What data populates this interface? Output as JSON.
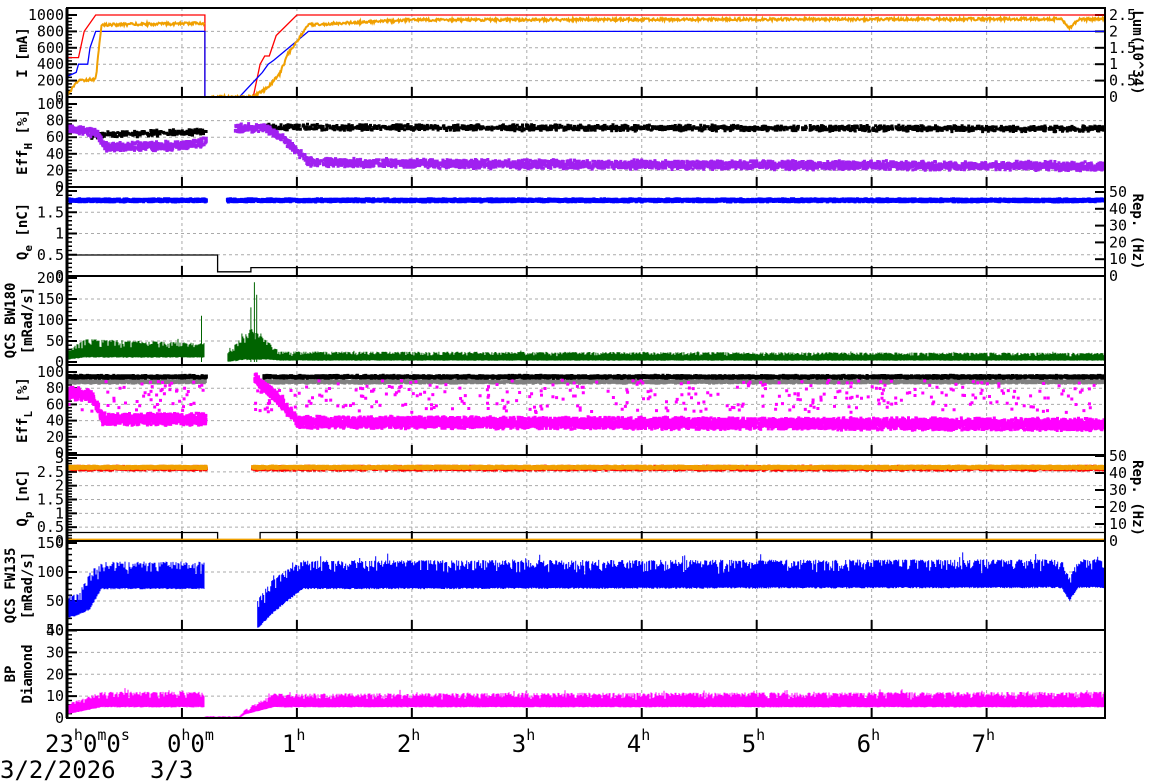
{
  "chart_data": {
    "type": "line",
    "title": "",
    "x_axis": {
      "unit": "hours since 23h0m0s",
      "range": [
        0,
        9.03
      ],
      "tick_labels": [
        {
          "t": 0,
          "text": "23h0m0s"
        },
        {
          "t": 1,
          "text": "0h0m"
        },
        {
          "t": 2,
          "text": "1h"
        },
        {
          "t": 3,
          "text": "2h"
        },
        {
          "t": 4,
          "text": "3h"
        },
        {
          "t": 5,
          "text": "4h"
        },
        {
          "t": 6,
          "text": "5h"
        },
        {
          "t": 7,
          "text": "6h"
        },
        {
          "t": 8,
          "text": "7h"
        }
      ],
      "date_labels": [
        {
          "t": 0,
          "text": "3/2/2026"
        },
        {
          "t": 0.85,
          "text": "3/3"
        }
      ]
    },
    "panels": [
      {
        "id": "current",
        "ylabel": "I [mA]",
        "ylim": [
          0,
          1000
        ],
        "yticks": [
          0,
          200,
          400,
          600,
          800,
          1000
        ],
        "right": {
          "label": "Lum(10^34)",
          "ylim": [
            0,
            2.5
          ],
          "yticks": [
            "0",
            "0.5",
            "1",
            "1.5",
            "2",
            "2.5"
          ]
        },
        "series": [
          {
            "name": "ler-current",
            "color": "#ff0000",
            "kind": "line",
            "segments": [
              [
                [
                  0,
                  480
                ],
                [
                  0.1,
                  480
                ],
                [
                  0.15,
                  800
                ],
                [
                  0.25,
                  1000
                ],
                [
                  1.2,
                  1000
                ],
                [
                  1.2,
                  0
                ],
                [
                  1.62,
                  0
                ],
                [
                  1.68,
                  400
                ],
                [
                  1.72,
                  500
                ],
                [
                  1.76,
                  500
                ],
                [
                  1.82,
                  750
                ],
                [
                  2.0,
                  1000
                ],
                [
                  9.03,
                  1000
                ]
              ]
            ]
          },
          {
            "name": "her-current",
            "color": "#0000ff",
            "kind": "line",
            "segments": [
              [
                [
                  0,
                  250
                ],
                [
                  0.08,
                  300
                ],
                [
                  0.1,
                  400
                ],
                [
                  0.18,
                  400
                ],
                [
                  0.2,
                  600
                ],
                [
                  0.25,
                  800
                ],
                [
                  1.2,
                  800
                ],
                [
                  1.2,
                  0
                ],
                [
                  1.5,
                  0
                ],
                [
                  1.7,
                  300
                ],
                [
                  1.75,
                  400
                ],
                [
                  1.8,
                  450
                ],
                [
                  2.1,
                  800
                ],
                [
                  9.03,
                  800
                ]
              ]
            ]
          },
          {
            "name": "luminosity",
            "color": "#f0a000",
            "kind": "noisyline",
            "axis": "right",
            "noise": 0.04,
            "segments": [
              [
                [
                  0,
                  0.05
                ],
                [
                  0.1,
                  0.5
                ],
                [
                  0.25,
                  0.55
                ],
                [
                  0.3,
                  2.2
                ],
                [
                  1.2,
                  2.25
                ]
              ],
              [
                [
                  1.25,
                  0
                ],
                [
                  1.62,
                  0
                ],
                [
                  1.75,
                  0.3
                ],
                [
                  1.85,
                  0.7
                ],
                [
                  1.92,
                  1.3
                ],
                [
                  2.1,
                  2.2
                ],
                [
                  3,
                  2.35
                ],
                [
                  8.65,
                  2.38
                ],
                [
                  8.72,
                  2.1
                ],
                [
                  8.8,
                  2.36
                ],
                [
                  9.03,
                  2.38
                ]
              ]
            ]
          }
        ]
      },
      {
        "id": "eff-her",
        "ylabel": "Eff",
        "ysub": "H",
        "yunit": "[%]",
        "ylim": [
          0,
          100
        ],
        "yticks": [
          0,
          20,
          40,
          60,
          80,
          100
        ],
        "series": [
          {
            "name": "eff-h-black",
            "color": "#000000",
            "kind": "scatter",
            "noise": 4,
            "density": 700,
            "segments": [
              [
                [
                  0.2,
                  62
                ],
                [
                  1.2,
                  67
                ]
              ],
              [
                [
                  1.7,
                  72
                ],
                [
                  9.03,
                  70
                ]
              ]
            ]
          },
          {
            "name": "eff-h-purple",
            "color": "#a020f0",
            "kind": "scatter",
            "noise": 6,
            "density": 1400,
            "segments": [
              [
                [
                  0,
                  70
                ],
                [
                  0.25,
                  65
                ],
                [
                  0.32,
                  48
                ],
                [
                  1.0,
                  50
                ],
                [
                  1.2,
                  55
                ]
              ],
              [
                [
                  1.45,
                  70
                ],
                [
                  1.7,
                  72
                ],
                [
                  1.9,
                  55
                ],
                [
                  2.1,
                  30
                ],
                [
                  3,
                  28
                ],
                [
                  9.03,
                  25
                ]
              ]
            ]
          }
        ]
      },
      {
        "id": "charge-e",
        "ylabel": "Q",
        "ysub": "e",
        "yunit": "[nC]",
        "ylim": [
          0,
          2
        ],
        "yticks": [
          "0",
          "0.5",
          "1",
          "1.5",
          "2"
        ],
        "right": {
          "label": "Rep. (Hz)",
          "ylim": [
            0,
            50
          ],
          "yticks": [
            "0",
            "10",
            "20",
            "30",
            "40",
            "50"
          ]
        },
        "series": [
          {
            "name": "qe-blue",
            "color": "#0000ff",
            "kind": "scatter",
            "noise": 0.04,
            "density": 2500,
            "segments": [
              [
                [
                  0,
                  1.78
                ],
                [
                  1.2,
                  1.78
                ]
              ],
              [
                [
                  1.38,
                  1.78
                ],
                [
                  9.03,
                  1.78
                ]
              ]
            ]
          },
          {
            "name": "rep-e",
            "color": "#000000",
            "kind": "line",
            "axis": "right",
            "segments": [
              [
                [
                  0,
                  12.5
                ],
                [
                  1.31,
                  12.5
                ],
                [
                  1.31,
                  2.5
                ],
                [
                  1.6,
                  2.5
                ],
                [
                  1.6,
                  5
                ],
                [
                  9.03,
                  5
                ]
              ]
            ]
          }
        ]
      },
      {
        "id": "bw180",
        "ylabel": "QCS BW180",
        "yunit": "[mRad/s]",
        "ylim": [
          0,
          200
        ],
        "yticks": [
          0,
          50,
          100,
          150,
          200
        ],
        "series": [
          {
            "name": "bw180-dose",
            "color": "#006400",
            "kind": "band",
            "segments": [
              [
                [
                  0,
                  5,
                  25
                ],
                [
                  0.15,
                  10,
                  55
                ],
                [
                  1.2,
                  10,
                  45
                ]
              ],
              [
                [
                  1.4,
                  0,
                  30
                ],
                [
                  1.6,
                  5,
                  80
                ],
                [
                  1.7,
                  5,
                  60
                ],
                [
                  1.85,
                  3,
                  25
                ],
                [
                  9.03,
                  3,
                  22
                ]
              ]
            ],
            "spikes": [
              [
                1.17,
                110
              ],
              [
                1.63,
                190
              ],
              [
                1.65,
                160
              ],
              [
                1.6,
                130
              ]
            ]
          }
        ]
      },
      {
        "id": "eff-ler",
        "ylabel": "Eff",
        "ysub": "L",
        "yunit": "[%]",
        "ylim": [
          0,
          100
        ],
        "yticks": [
          0,
          20,
          40,
          60,
          80,
          100
        ],
        "series": [
          {
            "name": "eff-l-gray",
            "color": "#808080",
            "kind": "scatter",
            "noise": 2,
            "density": 1500,
            "segments": [
              [
                [
                  0,
                  88
                ],
                [
                  1.2,
                  88
                ]
              ],
              [
                [
                  1.7,
                  88
                ],
                [
                  9.03,
                  88
                ]
              ]
            ]
          },
          {
            "name": "eff-l-black",
            "color": "#000000",
            "kind": "scatter",
            "noise": 2,
            "density": 1500,
            "segments": [
              [
                [
                  0,
                  94
                ],
                [
                  1.2,
                  94
                ]
              ],
              [
                [
                  1.7,
                  94
                ],
                [
                  9.03,
                  94
                ]
              ]
            ]
          },
          {
            "name": "eff-l-magenta",
            "color": "#ff00ff",
            "kind": "scatter",
            "noise": 8,
            "density": 3000,
            "outliers": 0.05,
            "segments": [
              [
                [
                  0,
                  75
                ],
                [
                  0.2,
                  70
                ],
                [
                  0.3,
                  42
                ],
                [
                  1.2,
                  42
                ]
              ],
              [
                [
                  1.62,
                  92
                ],
                [
                  1.8,
                  70
                ],
                [
                  2.0,
                  38
                ],
                [
                  9.03,
                  35
                ]
              ]
            ]
          }
        ]
      },
      {
        "id": "charge-p",
        "ylabel": "Q",
        "ysub": "p",
        "yunit": "[nC]",
        "ylim": [
          0,
          3
        ],
        "yticks": [
          "0",
          "0.5",
          "1",
          "1.5",
          "2",
          "2.5",
          "3"
        ],
        "right": {
          "label": "Rep. (Hz)",
          "ylim": [
            0,
            50
          ],
          "yticks": [
            "0",
            "10",
            "20",
            "30",
            "40",
            "50"
          ]
        },
        "series": [
          {
            "name": "qp-red",
            "color": "#ff0000",
            "kind": "scatter",
            "noise": 0.08,
            "density": 1500,
            "segments": [
              [
                [
                  0,
                  2.63
                ],
                [
                  1.2,
                  2.63
                ]
              ],
              [
                [
                  1.6,
                  2.63
                ],
                [
                  9.03,
                  2.63
                ]
              ]
            ]
          },
          {
            "name": "qp-orange",
            "color": "#f0a000",
            "kind": "scatter",
            "noise": 0.05,
            "density": 2500,
            "segments": [
              [
                [
                  0,
                  2.66
                ],
                [
                  1.2,
                  2.66
                ]
              ],
              [
                [
                  1.6,
                  2.66
                ],
                [
                  9.03,
                  2.66
                ]
              ]
            ]
          },
          {
            "name": "rep-p",
            "color": "#000000",
            "kind": "line",
            "axis": "right",
            "segments": [
              [
                [
                  0,
                  5
                ],
                [
                  1.31,
                  5
                ],
                [
                  1.31,
                  0
                ],
                [
                  1.68,
                  0
                ],
                [
                  1.68,
                  5
                ],
                [
                  9.03,
                  5
                ]
              ]
            ]
          },
          {
            "name": "rep-p-orange",
            "color": "#f0a000",
            "kind": "line",
            "axis": "right",
            "segments": [
              [
                [
                  0,
                  1
                ],
                [
                  9.03,
                  1
                ]
              ]
            ]
          }
        ]
      },
      {
        "id": "fw135",
        "ylabel": "QCS FW135",
        "yunit": "[mRad/s]",
        "ylim": [
          0,
          150
        ],
        "yticks": [
          "50",
          "50",
          "100",
          "150"
        ],
        "series": [
          {
            "name": "fw135-dose",
            "color": "#0000ff",
            "kind": "band",
            "segments": [
              [
                [
                  0,
                  20,
                  60
                ],
                [
                  0.1,
                  25,
                  62
                ],
                [
                  0.2,
                  35,
                  100
                ],
                [
                  0.3,
                  70,
                  118
                ],
                [
                  1.2,
                  70,
                  118
                ],
                [
                  1.2,
                  0,
                  0
                ],
                [
                  1.6,
                  0,
                  0
                ]
              ],
              [
                [
                  1.65,
                  0,
                  50
                ],
                [
                  1.8,
                  30,
                  90
                ],
                [
                  2.05,
                  70,
                  120
                ],
                [
                  8.65,
                  72,
                  122
                ],
                [
                  8.72,
                  50,
                  90
                ],
                [
                  8.8,
                  72,
                  122
                ],
                [
                  9.03,
                  72,
                  122
                ]
              ]
            ]
          }
        ]
      },
      {
        "id": "diamond",
        "ylabel": "BP",
        "yunit": "Diamond",
        "ylim": [
          0,
          50
        ],
        "yticks": [
          0,
          10,
          20,
          30,
          40
        ],
        "series": [
          {
            "name": "diamond-dose",
            "color": "#ff00ff",
            "kind": "band",
            "segments": [
              [
                [
                  0,
                  2,
                  8
                ],
                [
                  0.3,
                  6,
                  15
                ],
                [
                  1.2,
                  6,
                  15
                ],
                [
                  1.2,
                  0,
                  1
                ],
                [
                  1.5,
                  0,
                  1
                ],
                [
                  1.55,
                  2,
                  5
                ],
                [
                  1.8,
                  6,
                  14
                ],
                [
                  9.03,
                  6,
                  15
                ]
              ]
            ]
          }
        ]
      }
    ]
  }
}
